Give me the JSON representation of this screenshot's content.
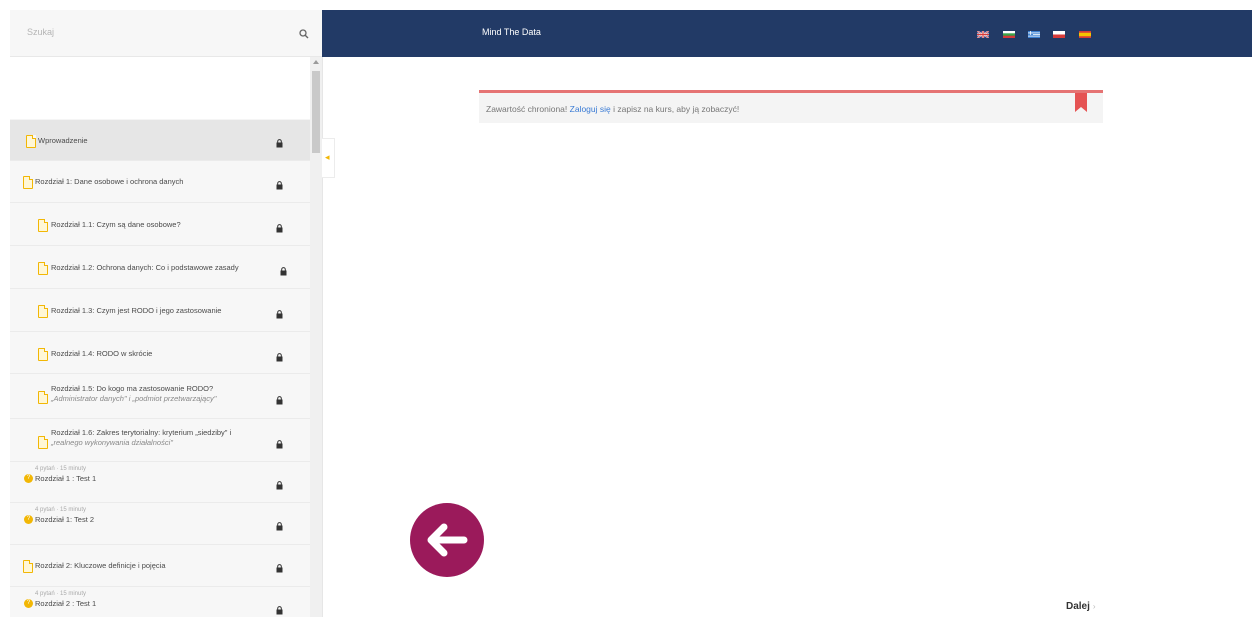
{
  "header": {
    "site_title": "Mind The Data",
    "languages": [
      {
        "name": "english-flag",
        "colors": [
          "#2b3f86",
          "#d63a3a"
        ]
      },
      {
        "name": "bulgarian-flag",
        "colors": [
          "#ffffff",
          "#3aa845",
          "#d63a3a"
        ]
      },
      {
        "name": "greek-flag",
        "colors": [
          "#3b7fd1",
          "#ffffff"
        ]
      },
      {
        "name": "polish-flag",
        "colors": [
          "#ffffff",
          "#d63a3a"
        ]
      },
      {
        "name": "spanish-flag",
        "colors": [
          "#d63a3a",
          "#f2c500"
        ]
      }
    ],
    "bg_color": "#223a66"
  },
  "sidebar": {
    "search_placeholder": "Szukaj",
    "items": [
      {
        "label": "Wprowadzenie",
        "type": "lesson",
        "active": true
      },
      {
        "label": "Rozdział 1: Dane osobowe i ochrona danych",
        "type": "lesson"
      },
      {
        "label": "Rozdział 1.1: Czym są dane osobowe?",
        "type": "lesson",
        "indent": true
      },
      {
        "label": "Rozdział 1.2: Ochrona danych: Co i podstawowe zasady",
        "type": "lesson",
        "indent": true
      },
      {
        "label": "Rozdział 1.3: Czym jest RODO i jego zastosowanie",
        "type": "lesson",
        "indent": true
      },
      {
        "label": "Rozdział 1.4: RODO w skrócie",
        "type": "lesson",
        "indent": true
      },
      {
        "label": "Rozdział 1.5: Do kogo ma zastosowanie RODO?",
        "label2": "„Administrator danych\" i „podmiot przetwarzający\"",
        "type": "lesson",
        "indent": true
      },
      {
        "label": "Rozdział 1.6: Zakres terytorialny: kryterium „siedziby\" i",
        "label2": "„realnego wykonywania działalności\"",
        "type": "lesson",
        "indent": true
      },
      {
        "sub": "4 pytań · 15 minuty",
        "label": "Rozdział 1 : Test 1",
        "type": "quiz"
      },
      {
        "sub": "4 pytań · 15 minuty",
        "label": "Rozdział 1: Test 2",
        "type": "quiz"
      },
      {
        "label": "Rozdział 2: Kluczowe definicje i pojęcia",
        "type": "lesson"
      },
      {
        "sub": "4 pytań · 15 minuty",
        "label": "Rozdział 2 : Test 1",
        "type": "quiz"
      }
    ]
  },
  "notice": {
    "text_before": "Zawartość chroniona!",
    "link_text": "Zaloguj się",
    "text_after": "i zapisz na kurs, aby ją zobaczyć!",
    "accent_color": "#e57373"
  },
  "navigation": {
    "next_label": "Dalej",
    "back_icon": "arrow-left-icon",
    "back_color": "#9b1a5b"
  }
}
